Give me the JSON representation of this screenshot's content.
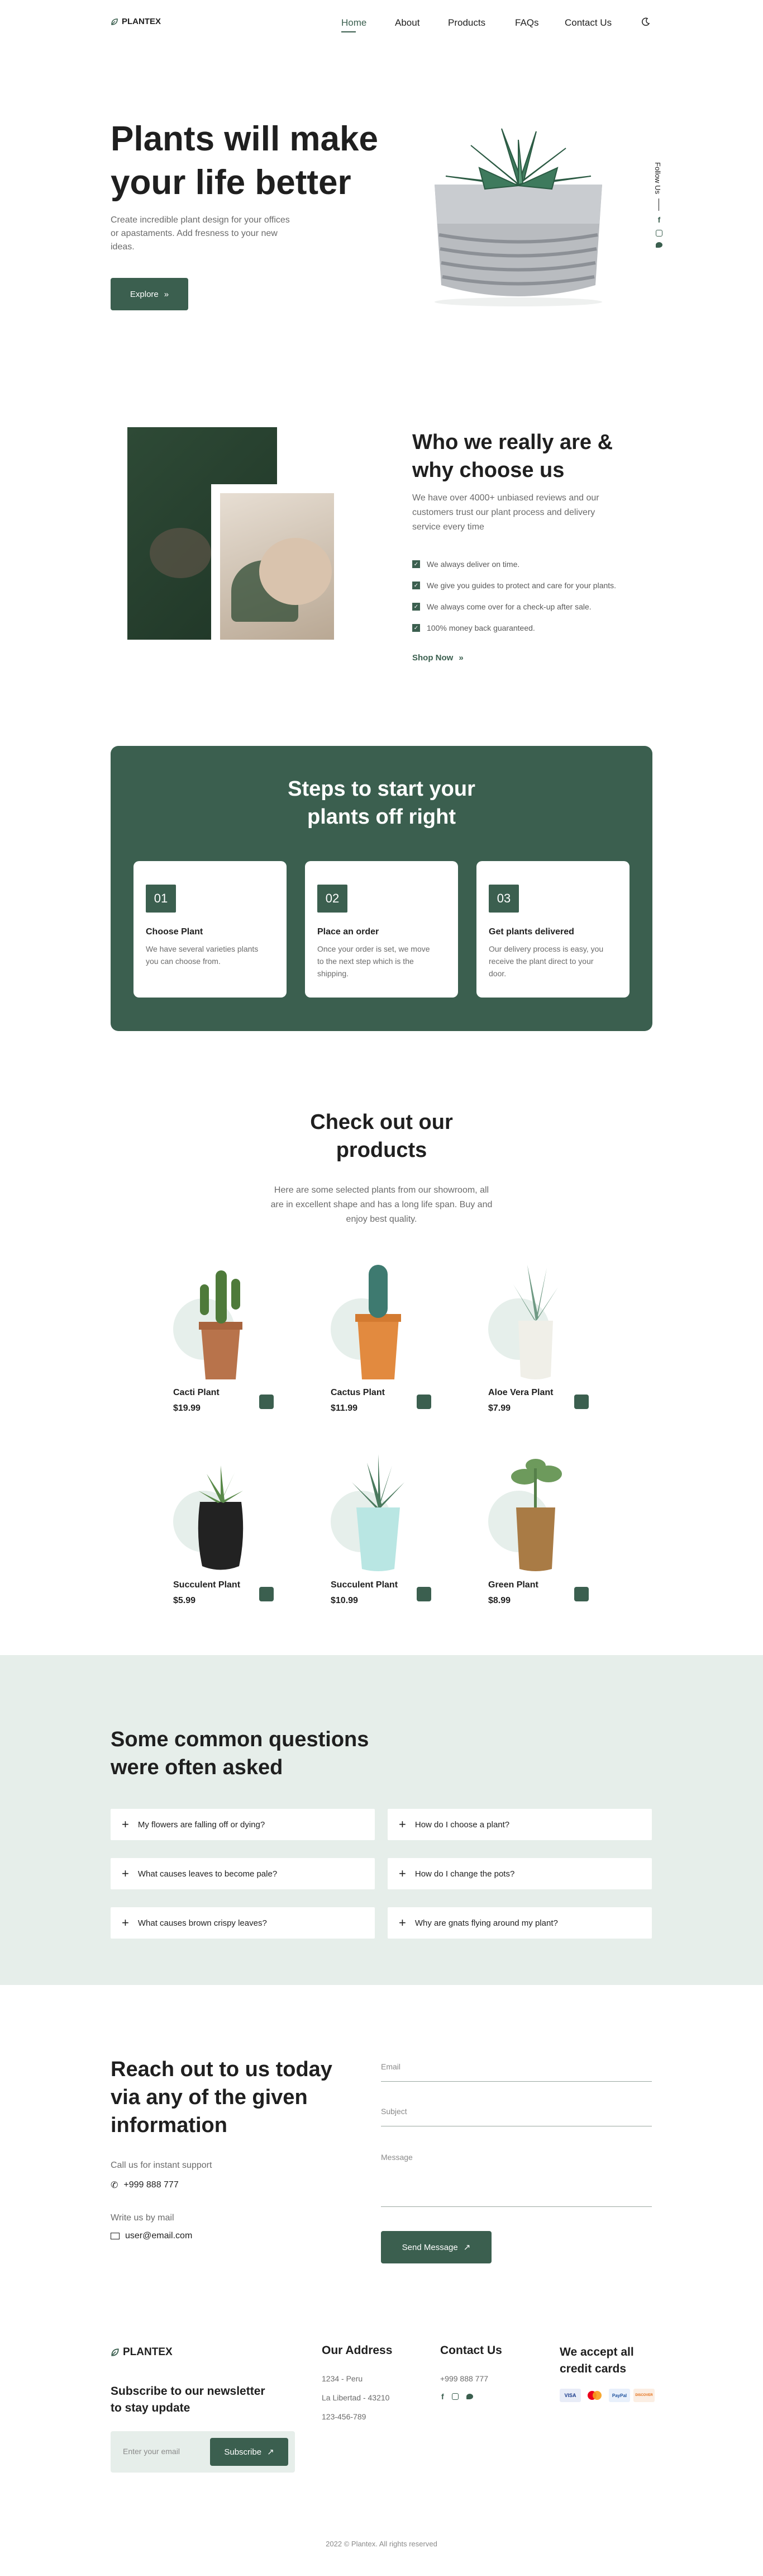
{
  "brand": {
    "logo": "PLANTEX"
  },
  "nav": {
    "items": [
      "Home",
      "About",
      "Products",
      "FAQs",
      "Contact Us"
    ],
    "active": "Home"
  },
  "hero": {
    "title_line1": "Plants will make",
    "title_line2": "your life better",
    "subtitle_line1": "Create incredible plant design for your offices",
    "subtitle_line2": "or apastaments. Add fresness to your new",
    "subtitle_line3": "ideas.",
    "cta": "Explore",
    "follow": "Follow Us"
  },
  "about": {
    "title_line1": "Who we really are &",
    "title_line2": "why choose us",
    "desc_line1": "We have over 4000+ unbiased reviews and our",
    "desc_line2": "customers trust our plant process and delivery",
    "desc_line3": "service every time",
    "checks": [
      "We always deliver on time.",
      "We give you guides to protect and care for your plants.",
      "We always come over for a check-up after sale.",
      "100% money back guaranteed."
    ],
    "link": "Shop Now"
  },
  "steps": {
    "title_line1": "Steps to start your",
    "title_line2": "plants off right",
    "items": [
      {
        "num": "01",
        "title": "Choose Plant",
        "desc": "We have several varieties plants you can choose from."
      },
      {
        "num": "02",
        "title": "Place an order",
        "desc": "Once your order is set, we move to the next step which is the shipping."
      },
      {
        "num": "03",
        "title": "Get plants delivered",
        "desc": "Our delivery process is easy, you receive the plant direct to your door."
      }
    ]
  },
  "products": {
    "title_line1": "Check out our",
    "title_line2": "products",
    "desc_line1": "Here are some selected plants from our showroom, all",
    "desc_line2": "are in excellent shape and has a long life span. Buy and",
    "desc_line3": "enjoy best quality.",
    "items": [
      {
        "name": "Cacti Plant",
        "price": "$19.99"
      },
      {
        "name": "Cactus Plant",
        "price": "$11.99"
      },
      {
        "name": "Aloe Vera Plant",
        "price": "$7.99"
      },
      {
        "name": "Succulent Plant",
        "price": "$5.99"
      },
      {
        "name": "Succulent Plant",
        "price": "$10.99"
      },
      {
        "name": "Green Plant",
        "price": "$8.99"
      }
    ]
  },
  "faq": {
    "title_line1": "Some common questions",
    "title_line2": "were often asked",
    "items": [
      "My flowers are falling off or dying?",
      "How do I choose a plant?",
      "What causes leaves to become pale?",
      "How do I change the pots?",
      "What causes brown crispy leaves?",
      "Why are gnats flying around my plant?"
    ]
  },
  "contact": {
    "title_line1": "Reach out to us today",
    "title_line2": "via any of the given",
    "title_line3": "information",
    "call_label": "Call us for instant support",
    "phone": "+999 888 777",
    "write_label": "Write us by mail",
    "email": "user@email.com",
    "form": {
      "email": "Email",
      "subject": "Subject",
      "message": "Message",
      "submit": "Send Message"
    }
  },
  "footer": {
    "logo": "PLANTEX",
    "newsletter_line1": "Subscribe to our newsletter",
    "newsletter_line2": "to stay update",
    "newsletter_placeholder": "Enter your email",
    "subscribe": "Subscribe",
    "address_title": "Our Address",
    "address_lines": [
      "1234 - Peru",
      "La Libertad - 43210",
      "123-456-789"
    ],
    "contact_title": "Contact Us",
    "contact_phone": "+999 888 777",
    "cards_title_line1": "We accept all",
    "cards_title_line2": "credit cards",
    "cards": [
      "VISA",
      "",
      "PayPal",
      "DISCOVER"
    ],
    "copyright": "2022 © Plantex. All rights reserved"
  },
  "colors": {
    "accent": "#3b5f4f",
    "section_bg": "#e6eeea"
  }
}
